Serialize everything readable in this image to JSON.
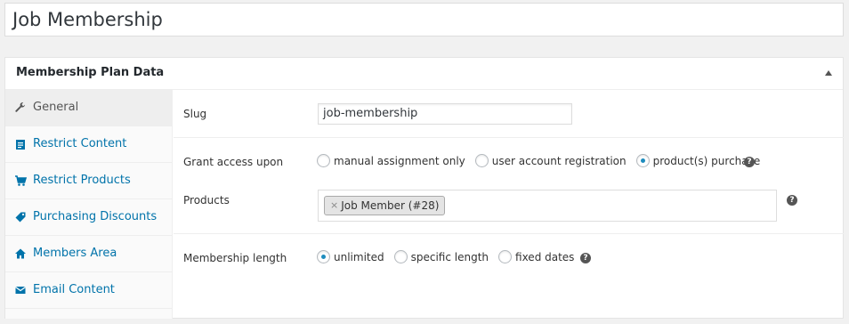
{
  "post_title": "Job Membership",
  "panel": {
    "title": "Membership Plan Data",
    "toggle_icon": "arrow-up-icon"
  },
  "tabs": [
    {
      "label": "General",
      "icon": "wrench-icon",
      "active": true
    },
    {
      "label": "Restrict Content",
      "icon": "document-icon"
    },
    {
      "label": "Restrict Products",
      "icon": "cart-icon"
    },
    {
      "label": "Purchasing Discounts",
      "icon": "tag-icon"
    },
    {
      "label": "Members Area",
      "icon": "home-icon"
    },
    {
      "label": "Email Content",
      "icon": "envelope-icon"
    }
  ],
  "fields": {
    "slug": {
      "label": "Slug",
      "value": "job-membership"
    },
    "grant_access": {
      "label": "Grant access upon",
      "options": [
        "manual assignment only",
        "user account registration",
        "product(s) purchase"
      ],
      "selected": "product(s) purchase",
      "help": "?"
    },
    "products": {
      "label": "Products",
      "chips": [
        {
          "remove": "×",
          "label": "Job Member (#28)"
        }
      ],
      "help": "?"
    },
    "membership_length": {
      "label": "Membership length",
      "options": [
        "unlimited",
        "specific length",
        "fixed dates"
      ],
      "selected": "unlimited",
      "help": "?"
    }
  },
  "colors": {
    "link": "#0073aa",
    "radio_checked": "#1e8cbe",
    "background": "#f1f1f1"
  }
}
